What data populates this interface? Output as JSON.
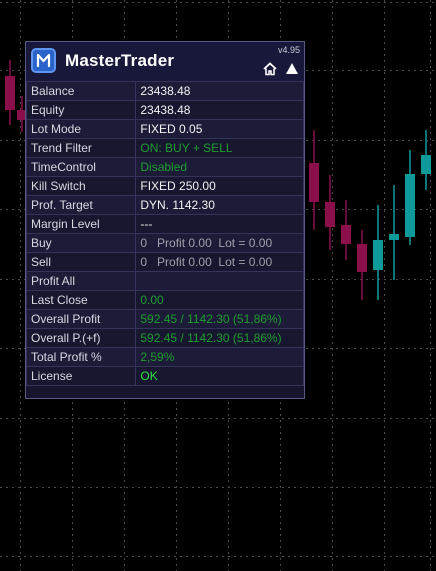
{
  "panel": {
    "title": "MasterTrader",
    "version": "v4.95",
    "icons": {
      "logo": "m-logo-icon",
      "home": "home-icon",
      "collapse": "triangle-up-icon"
    }
  },
  "rows": [
    {
      "label": "Balance",
      "value": "23438.48",
      "color": "white"
    },
    {
      "label": "Equity",
      "value": "23438.48",
      "color": "white"
    },
    {
      "label": "Lot Mode",
      "value": "FIXED 0.05",
      "color": "white"
    },
    {
      "label": "Trend Filter",
      "value": "ON: BUY + SELL",
      "color": "green"
    },
    {
      "label": "TimeControl",
      "value": "Disabled",
      "color": "green"
    },
    {
      "label": "Kill Switch",
      "value": "FIXED 250.00",
      "color": "white"
    },
    {
      "label": "Prof. Target",
      "value": "DYN. 1142.30",
      "color": "white"
    },
    {
      "label": "Margin Level",
      "value": "---",
      "color": "white"
    },
    {
      "label": "Buy",
      "value": "0   Profit 0.00  Lot = 0.00",
      "color": "grey"
    },
    {
      "label": "Sell",
      "value": "0   Profit 0.00  Lot = 0.00",
      "color": "grey"
    },
    {
      "label": "Profit All",
      "value": "",
      "color": "white"
    },
    {
      "label": "Last Close",
      "value": "0.00",
      "color": "green"
    },
    {
      "label": "Overall Profit",
      "value": "592.45 / 1142.30 (51,86%)",
      "color": "green"
    },
    {
      "label": "Overall P.(+f)",
      "value": "592.45 / 1142.30 (51,86%)",
      "color": "green"
    },
    {
      "label": "Total Profit %",
      "value": "2,59%",
      "color": "green"
    },
    {
      "label": "License",
      "value": "OK",
      "color": "brightgreen"
    }
  ],
  "colors": {
    "bull": "#0f9a9a",
    "bear": "#8a0f4a",
    "panel_bg": "#15152e",
    "value_green": "#1f9d2e",
    "ok_green": "#2fe23f"
  }
}
